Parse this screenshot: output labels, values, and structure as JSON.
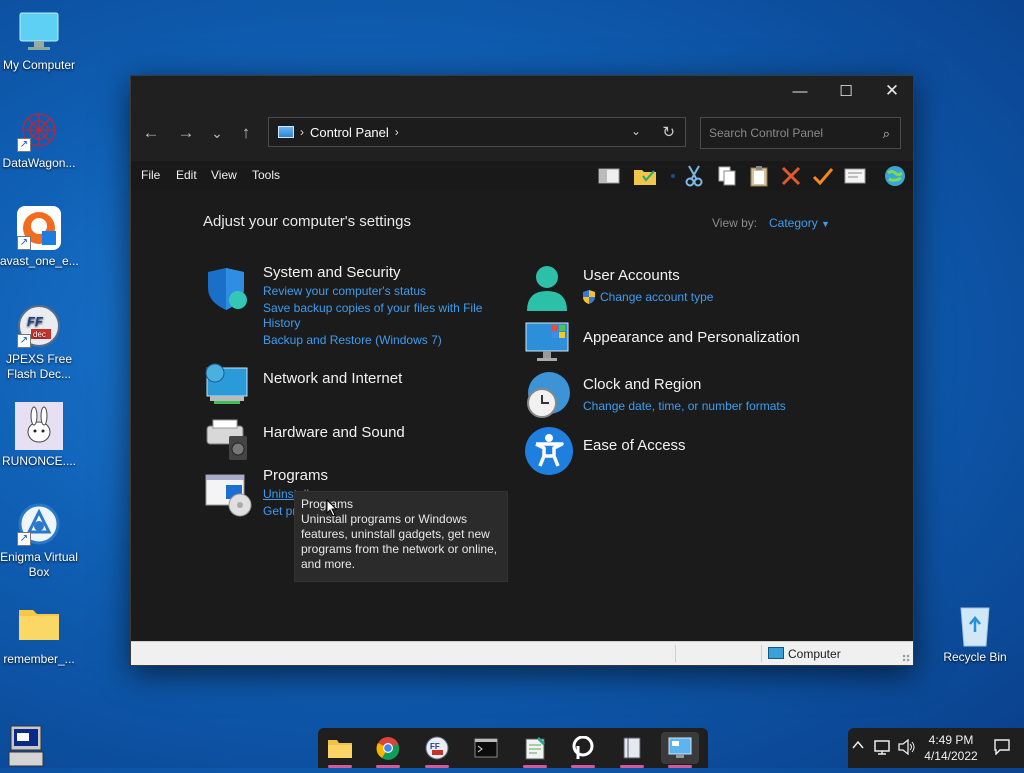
{
  "desktop": {
    "icons": [
      {
        "label": "My Computer"
      },
      {
        "label": "DataWagon..."
      },
      {
        "label": "avast_one_e..."
      },
      {
        "label": "JPEXS Free Flash Dec..."
      },
      {
        "label": "RUNONCE...."
      },
      {
        "label": "Enigma Virtual Box"
      },
      {
        "label": "remember_..."
      },
      {
        "label": "Recycle Bin"
      }
    ]
  },
  "window": {
    "title_buttons": {
      "minimize": "—",
      "maximize": "☐",
      "close": "✕"
    },
    "nav": {
      "back": "←",
      "forward": "→",
      "recent": "⌄",
      "up": "↑"
    },
    "address": {
      "crumb": "Control Panel",
      "sep_before": "›",
      "sep_after": "›",
      "dropdown": "⌄",
      "refresh": "↻"
    },
    "search": {
      "placeholder": "Search Control Panel",
      "icon": "⌕"
    },
    "menubar": [
      "File",
      "Edit",
      "View",
      "Tools"
    ],
    "heading": "Adjust your computer's settings",
    "view_by_label": "View by:",
    "view_by_value": "Category",
    "categories_left": [
      {
        "title": "System and Security",
        "links": [
          "Review your computer's status",
          "Save backup copies of your files with File History",
          "Backup and Restore (Windows 7)"
        ]
      },
      {
        "title": "Network and Internet",
        "links": []
      },
      {
        "title": "Hardware and Sound",
        "links": []
      },
      {
        "title": "Programs",
        "links": [
          "Uninstall a program",
          "Get pro"
        ]
      }
    ],
    "categories_right": [
      {
        "title": "User Accounts",
        "links": [
          "Change account type"
        ]
      },
      {
        "title": "Appearance and Personalization",
        "links": []
      },
      {
        "title": "Clock and Region",
        "links": [
          "Change date, time, or number formats"
        ]
      },
      {
        "title": "Ease of Access",
        "links": []
      }
    ],
    "tooltip": {
      "title": "Programs",
      "body": "Uninstall programs or Windows features, uninstall gadgets, get new programs from the network or online, and more."
    },
    "status": {
      "location": "Computer"
    }
  },
  "taskbar": {
    "apps": [
      "file-explorer-icon",
      "chrome-icon",
      "ffdec-icon",
      "terminal-icon",
      "notepad-icon",
      "pcloud-icon",
      "book-icon",
      "control-panel-icon"
    ],
    "clock_time": "4:49 PM",
    "clock_date": "4/14/2022"
  },
  "colors": {
    "link": "#3c9df0",
    "window_bg": "#202020",
    "desktop": "#1565c0"
  }
}
